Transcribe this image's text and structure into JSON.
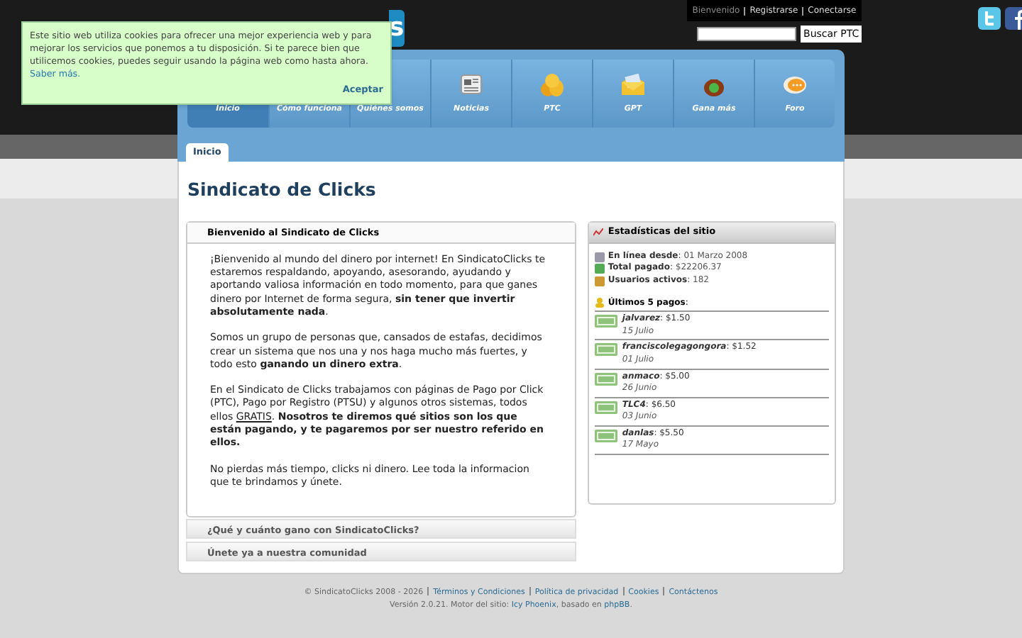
{
  "cookie_notice": {
    "text": "Este sitio web utiliza cookies para ofrecer una mejor experiencia web y para mejorar los servicios que ponemos a tu disposición. Si te parece bien que utilicemos cookies, puedes seguir usando la página web como hasta ahora.",
    "link": "Saber más.",
    "button": "Aceptar"
  },
  "logo_fragment": "s",
  "user_links": [
    "Bienvenido",
    "Registrarse",
    "Conectarse"
  ],
  "search": {
    "button": "Buscar PTC"
  },
  "nav": [
    {
      "label": "Inicio",
      "selected": true
    },
    {
      "label": "Cómo funciona",
      "selected": false
    },
    {
      "label": "Quiénes somos",
      "selected": false
    },
    {
      "label": "Noticias",
      "selected": false
    },
    {
      "label": "PTC",
      "selected": false
    },
    {
      "label": "GPT",
      "selected": false
    },
    {
      "label": "Gana más",
      "selected": false
    },
    {
      "label": "Foro",
      "selected": false
    }
  ],
  "breadcrumb_tab": "Inicio",
  "page_title": "Sindicato de Clicks",
  "welcome": {
    "title": "Bienvenido al Sindicato de Clicks",
    "paragraphs": [
      [
        {
          "text": "¡Bienvenido al mundo del dinero por internet! En SindicatoClicks te estaremos respaldando, apoyando, asesorando, ayudando y aportando valiosa información en todo momento, para que ganes dinero por Internet de forma segura, **sin tener que invertir absolutamente nada**."
        }
      ],
      [
        {
          "text": "Somos un grupo de personas que, cansados de estafas, decidimos crear un sistema que nos una y nos haga mucho más fuertes, y todo esto **ganando un dinero extra**."
        }
      ],
      [
        {
          "text": "En el Sindicato de Clicks trabajamos con páginas de Pago por Click (PTC), Pago por Registro (PTSU) y algunos otros sistemas, todos ellos "
        },
        {
          "text": "GRATIS",
          "kind": "link"
        },
        {
          "text": ". **Nosotros te diremos qué sitios son los que están pagando, y te pagaremos por ser nuestro referido en ellos.**"
        }
      ],
      [
        {
          "text": "No pierdas más tiempo, clicks ni dinero. Lee toda la informacion que te brindamos y únete."
        }
      ]
    ]
  },
  "collapsed_panels": [
    {
      "title": "¿Qué y cuánto gano con SindicatoClicks?",
      "expanded": false
    },
    {
      "title": "Únete ya a nuestra comunidad",
      "expanded": false
    }
  ],
  "stats": {
    "title": "Estadísticas del sitio",
    "items": [
      {
        "label": "**En línea desde**:",
        "value": "01 Marzo 2008"
      },
      {
        "label": "**Total pagado**:",
        "value": "$22206.37"
      },
      {
        "label": "**Usuarios activos**:",
        "value": "182"
      }
    ],
    "payments_label": "**Últimos 5 pagos**:",
    "payments": [
      {
        "user": "jalvarez",
        "amount": ": $1.50",
        "date": "15 Julio"
      },
      {
        "user": "franciscolegagongora",
        "amount": ": $1.52",
        "date": "01 Julio"
      },
      {
        "user": "anmaco",
        "amount": ": $5.00",
        "date": "26 Junio"
      },
      {
        "user": "TLC4",
        "amount": ": $6.50",
        "date": "03 Junio"
      },
      {
        "user": "danlas",
        "amount": ": $5.50",
        "date": "17 Mayo"
      }
    ]
  },
  "footer": {
    "line1": [
      {
        "text": "© SindicatoClicks 2008 - 2026"
      },
      {
        "text": "Términos y Condiciones",
        "kind": "link"
      },
      {
        "text": "Política de privacidad",
        "kind": "link"
      },
      {
        "text": "Cookies",
        "kind": "link"
      },
      {
        "text": "Contáctenos",
        "kind": "link"
      }
    ],
    "line2": [
      {
        "text": "Versión 2.0.21. Motor del sitio:"
      },
      {
        "text": "Icy Phoenix",
        "kind": "link"
      },
      {
        "text": ", basado en"
      },
      {
        "text": "phpBB",
        "kind": "link"
      },
      {
        "text": "."
      }
    ]
  }
}
